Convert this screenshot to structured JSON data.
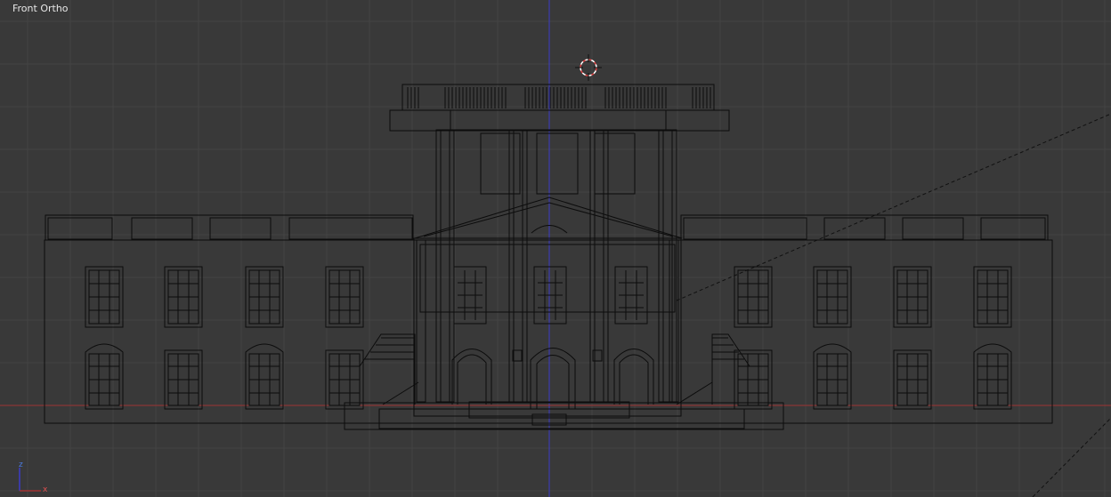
{
  "viewport": {
    "view_label": "Front Ortho",
    "background_color": "#393939",
    "grid_color": "#444444",
    "wire_color": "#0c0c0c",
    "z_axis_color": "#3c3cc8",
    "x_axis_color": "#a03232",
    "cursor_color": "#e04040"
  },
  "axis_gizmo": {
    "z_label": "z",
    "x_label": "x"
  }
}
